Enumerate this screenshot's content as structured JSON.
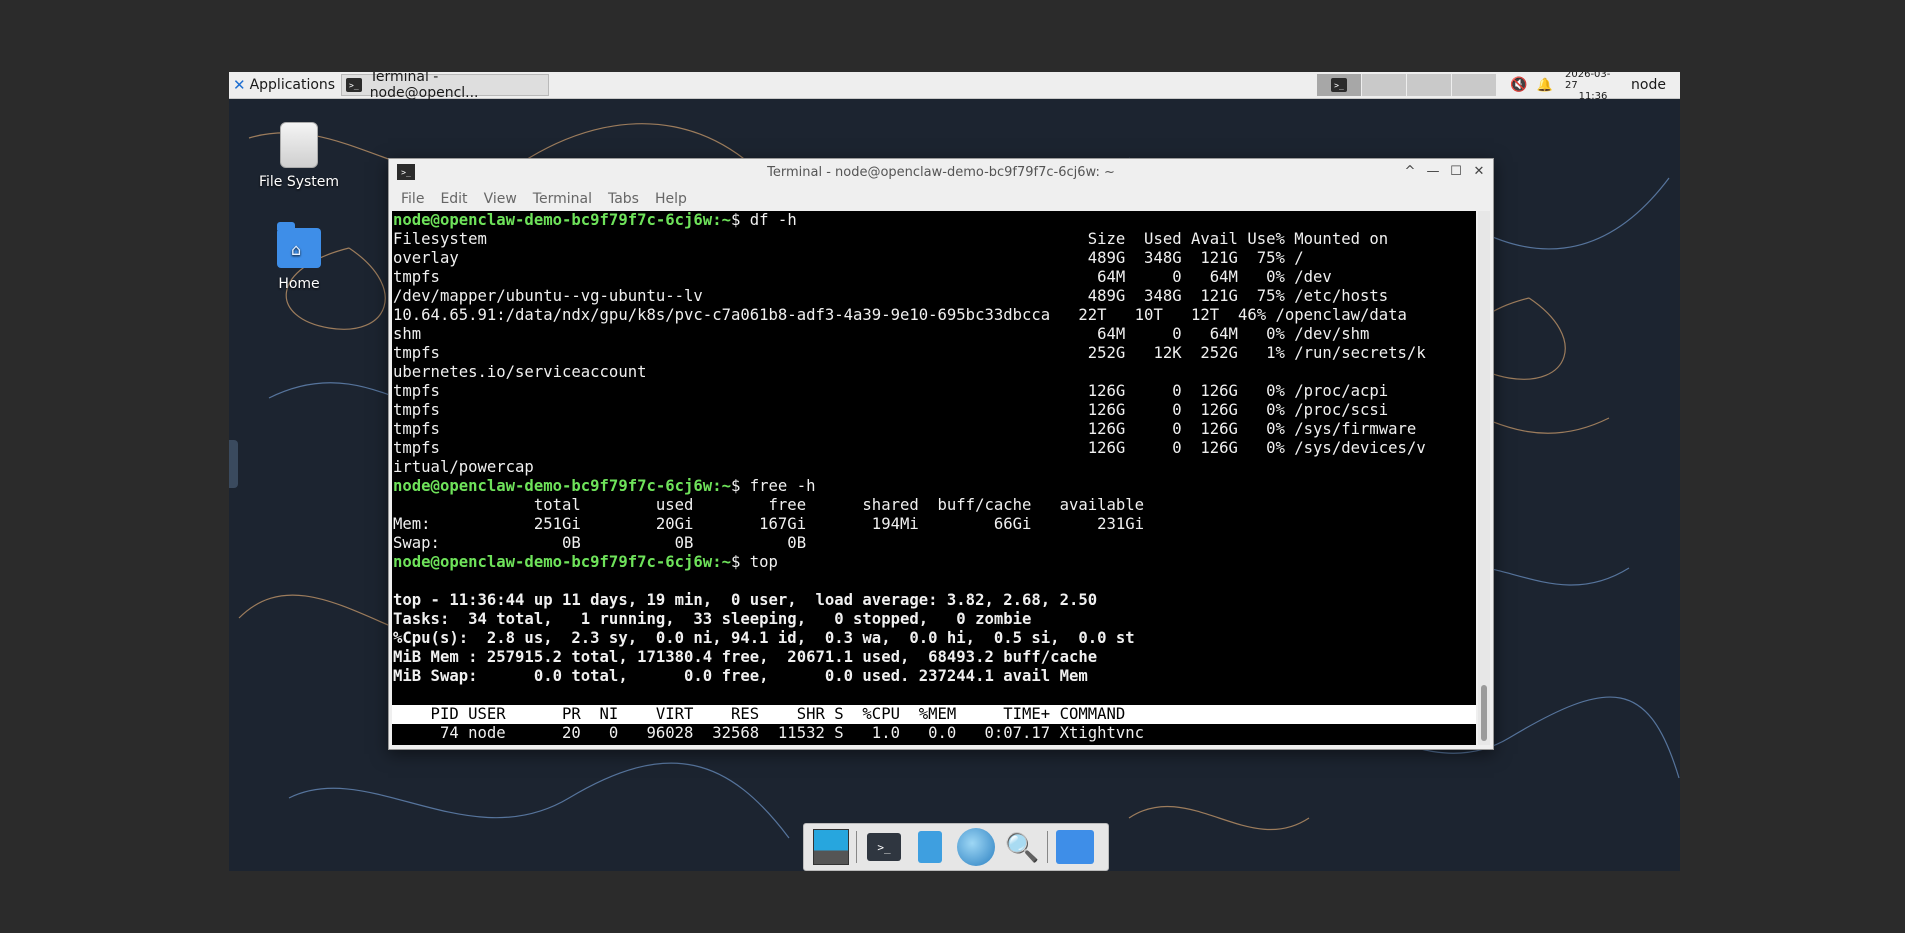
{
  "panel": {
    "applications_label": "Applications",
    "task_label": "Terminal - node@opencl...",
    "clock_date": "2026-03-27",
    "clock_time": "11:36",
    "user": "node"
  },
  "desktop_icons": {
    "file_system": "File System",
    "home": "Home"
  },
  "window": {
    "title": "Terminal - node@openclaw-demo-bc9f79f7c-6cj6w: ~",
    "menu": [
      "File",
      "Edit",
      "View",
      "Terminal",
      "Tabs",
      "Help"
    ]
  },
  "terminal": {
    "prompt": "node@openclaw-demo-bc9f79f7c-6cj6w",
    "cmd_df": "df -h",
    "df_lines": [
      "Filesystem                                                                Size  Used Avail Use% Mounted on",
      "overlay                                                                   489G  348G  121G  75% /",
      "tmpfs                                                                      64M     0   64M   0% /dev",
      "/dev/mapper/ubuntu--vg-ubuntu--lv                                         489G  348G  121G  75% /etc/hosts",
      "10.64.65.91:/data/ndx/gpu/k8s/pvc-c7a061b8-adf3-4a39-9e10-695bc33dbcca   22T   10T   12T  46% /openclaw/data",
      "shm                                                                        64M     0   64M   0% /dev/shm",
      "tmpfs                                                                     252G   12K  252G   1% /run/secrets/k",
      "ubernetes.io/serviceaccount",
      "tmpfs                                                                     126G     0  126G   0% /proc/acpi",
      "tmpfs                                                                     126G     0  126G   0% /proc/scsi",
      "tmpfs                                                                     126G     0  126G   0% /sys/firmware",
      "tmpfs                                                                     126G     0  126G   0% /sys/devices/v",
      "irtual/powercap"
    ],
    "cmd_free": "free -h",
    "free_lines": [
      "               total        used        free      shared  buff/cache   available",
      "Mem:           251Gi        20Gi       167Gi       194Mi        66Gi       231Gi",
      "Swap:             0B          0B          0B"
    ],
    "cmd_top": "top",
    "top_lines": [
      "",
      "top - 11:36:44 up 11 days, 19 min,  0 user,  load average: 3.82, 2.68, 2.50",
      "Tasks:  34 total,   1 running,  33 sleeping,   0 stopped,   0 zombie",
      "%Cpu(s):  2.8 us,  2.3 sy,  0.0 ni, 94.1 id,  0.3 wa,  0.0 hi,  0.5 si,  0.0 st",
      "MiB Mem : 257915.2 total, 171380.4 free,  20671.1 used,  68493.2 buff/cache",
      "MiB Swap:      0.0 total,      0.0 free,      0.0 used. 237244.1 avail Mem",
      ""
    ],
    "top_header": "    PID USER      PR  NI    VIRT    RES    SHR S  %CPU  %MEM     TIME+ COMMAND",
    "top_row": "     74 node      20   0   96028  32568  11532 S   1.0   0.0   0:07.17 Xtightvnc"
  },
  "colors": {
    "prompt_green": "#6ee25a",
    "terminal_bg": "#000000",
    "desktop_bg": "#1c2430"
  }
}
